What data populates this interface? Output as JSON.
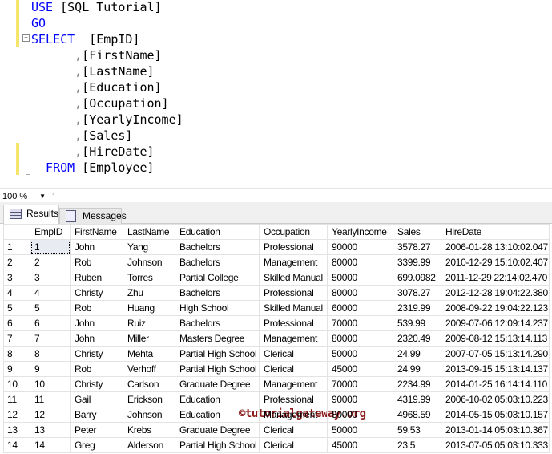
{
  "editor": {
    "lines": [
      [
        {
          "t": "USE",
          "c": "kw"
        },
        {
          "t": " [SQL Tutorial]",
          "c": ""
        }
      ],
      [
        {
          "t": "GO",
          "c": "kw"
        }
      ],
      [
        {
          "t": "SELECT",
          "c": "kw"
        },
        {
          "t": "  [EmpID]",
          "c": ""
        }
      ],
      [
        {
          "t": "      ,",
          "c": "op"
        },
        {
          "t": "[FirstName]",
          "c": ""
        }
      ],
      [
        {
          "t": "      ,",
          "c": "op"
        },
        {
          "t": "[LastName]",
          "c": ""
        }
      ],
      [
        {
          "t": "      ,",
          "c": "op"
        },
        {
          "t": "[Education]",
          "c": ""
        }
      ],
      [
        {
          "t": "      ,",
          "c": "op"
        },
        {
          "t": "[Occupation]",
          "c": ""
        }
      ],
      [
        {
          "t": "      ,",
          "c": "op"
        },
        {
          "t": "[YearlyIncome]",
          "c": ""
        }
      ],
      [
        {
          "t": "      ,",
          "c": "op"
        },
        {
          "t": "[Sales]",
          "c": ""
        }
      ],
      [
        {
          "t": "      ,",
          "c": "op"
        },
        {
          "t": "[HireDate]",
          "c": ""
        }
      ],
      [
        {
          "t": "  FROM",
          "c": "kw"
        },
        {
          "t": " [Employee]",
          "c": ""
        }
      ]
    ]
  },
  "zoom": {
    "value": "100 %"
  },
  "tabs": {
    "results": "Results",
    "messages": "Messages"
  },
  "watermark": "©tutorialgateway.org",
  "grid": {
    "columns": [
      "",
      "EmpID",
      "FirstName",
      "LastName",
      "Education",
      "Occupation",
      "YearlyIncome",
      "Sales",
      "HireDate"
    ],
    "rows": [
      [
        "1",
        "1",
        "John",
        "Yang",
        "Bachelors",
        "Professional",
        "90000",
        "3578.27",
        "2006-01-28 13:10:02.047"
      ],
      [
        "2",
        "2",
        "Rob",
        "Johnson",
        "Bachelors",
        "Management",
        "80000",
        "3399.99",
        "2010-12-29 15:10:02.407"
      ],
      [
        "3",
        "3",
        "Ruben",
        "Torres",
        "Partial College",
        "Skilled Manual",
        "50000",
        "699.0982",
        "2011-12-29 22:14:02.470"
      ],
      [
        "4",
        "4",
        "Christy",
        "Zhu",
        "Bachelors",
        "Professional",
        "80000",
        "3078.27",
        "2012-12-28 19:04:22.380"
      ],
      [
        "5",
        "5",
        "Rob",
        "Huang",
        "High School",
        "Skilled Manual",
        "60000",
        "2319.99",
        "2008-09-22 19:04:22.123"
      ],
      [
        "6",
        "6",
        "John",
        "Ruiz",
        "Bachelors",
        "Professional",
        "70000",
        "539.99",
        "2009-07-06 12:09:14.237"
      ],
      [
        "7",
        "7",
        "John",
        "Miller",
        "Masters Degree",
        "Management",
        "80000",
        "2320.49",
        "2009-08-12 15:13:14.113"
      ],
      [
        "8",
        "8",
        "Christy",
        "Mehta",
        "Partial High School",
        "Clerical",
        "50000",
        "24.99",
        "2007-07-05 15:13:14.290"
      ],
      [
        "9",
        "9",
        "Rob",
        "Verhoff",
        "Partial High School",
        "Clerical",
        "45000",
        "24.99",
        "2013-09-15 15:13:14.137"
      ],
      [
        "10",
        "10",
        "Christy",
        "Carlson",
        "Graduate Degree",
        "Management",
        "70000",
        "2234.99",
        "2014-01-25 16:14:14.110"
      ],
      [
        "11",
        "11",
        "Gail",
        "Erickson",
        "Education",
        "Professional",
        "90000",
        "4319.99",
        "2006-10-02 05:03:10.223"
      ],
      [
        "12",
        "12",
        "Barry",
        "Johnson",
        "Education",
        "Management",
        "80000",
        "4968.59",
        "2014-05-15 05:03:10.157"
      ],
      [
        "13",
        "13",
        "Peter",
        "Krebs",
        "Graduate Degree",
        "Clerical",
        "50000",
        "59.53",
        "2013-01-14 05:03:10.367"
      ],
      [
        "14",
        "14",
        "Greg",
        "Alderson",
        "Partial High School",
        "Clerical",
        "45000",
        "23.5",
        "2013-07-05 05:03:10.333"
      ]
    ]
  }
}
